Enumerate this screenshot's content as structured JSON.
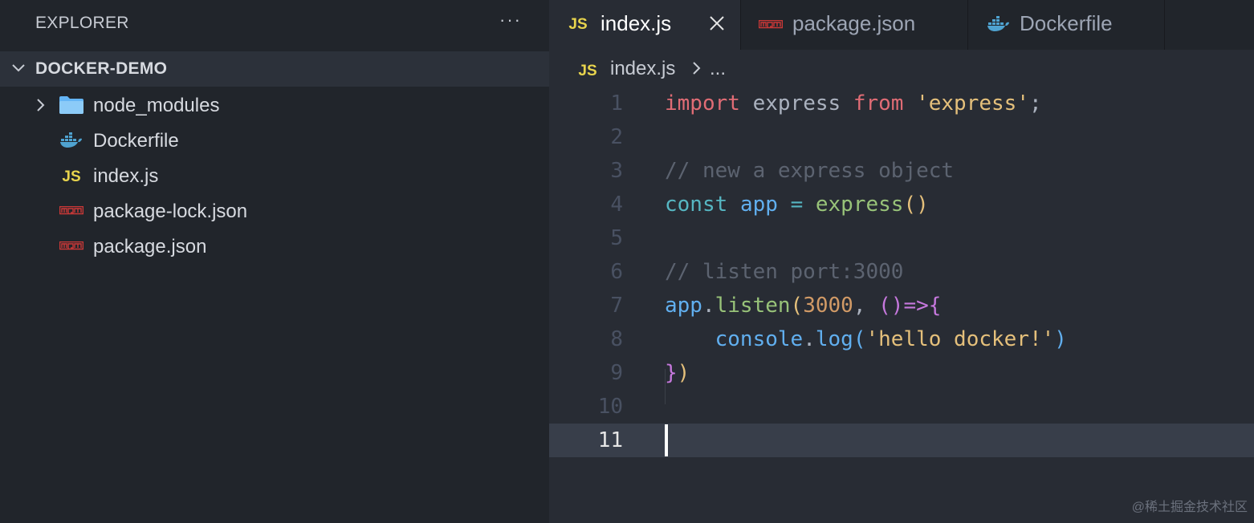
{
  "sidebar": {
    "title": "EXPLORER",
    "more": "···",
    "folder": "DOCKER-DEMO",
    "items": [
      {
        "label": "node_modules",
        "icon": "folder-icon"
      },
      {
        "label": "Dockerfile",
        "icon": "docker-icon"
      },
      {
        "label": "index.js",
        "icon": "js-icon"
      },
      {
        "label": "package-lock.json",
        "icon": "npm-icon"
      },
      {
        "label": "package.json",
        "icon": "npm-icon"
      }
    ]
  },
  "tabs": [
    {
      "label": "index.js",
      "icon": "js-icon",
      "active": true
    },
    {
      "label": "package.json",
      "icon": "npm-icon",
      "active": false
    },
    {
      "label": "Dockerfile",
      "icon": "docker-icon",
      "active": false
    }
  ],
  "breadcrumb": {
    "file": "index.js",
    "more": "..."
  },
  "editor": {
    "line_numbers": [
      "1",
      "2",
      "3",
      "4",
      "5",
      "6",
      "7",
      "8",
      "9",
      "10",
      "11"
    ],
    "current_line": 11,
    "lines": {
      "l1": {
        "t1": "import",
        "t2": " express ",
        "t3": "from",
        "t4": " ",
        "t5": "'express'",
        "t6": ";"
      },
      "l3": {
        "t1": "// new a express object"
      },
      "l4": {
        "t1": "const",
        "t2": " ",
        "t3": "app",
        "t4": " ",
        "t5": "=",
        "t6": " ",
        "t7": "express",
        "t8": "()"
      },
      "l6": {
        "t1": "// listen port:3000"
      },
      "l7": {
        "t1": "app",
        "t2": ".",
        "t3": "listen",
        "t4": "(",
        "t5": "3000",
        "t6": ", ",
        "t7": "()",
        "t8": "=>",
        "t9": "{"
      },
      "l8": {
        "t1": "    ",
        "t2": "console",
        "t3": ".",
        "t4": "log",
        "t5": "(",
        "t6": "'hello docker!'",
        "t7": ")"
      },
      "l9": {
        "t1": "}",
        "t2": ")"
      }
    }
  },
  "watermark": "@稀土掘金技术社区",
  "colors": {
    "sidebar_bg": "#21252b",
    "editor_bg": "#282c34",
    "selected_row": "#2c313a",
    "current_line": "#383e4a",
    "js_yellow": "#e8d44d",
    "npm_red": "#cb3837",
    "docker_blue": "#4fa3d1",
    "folder_blue": "#64b5f6"
  }
}
